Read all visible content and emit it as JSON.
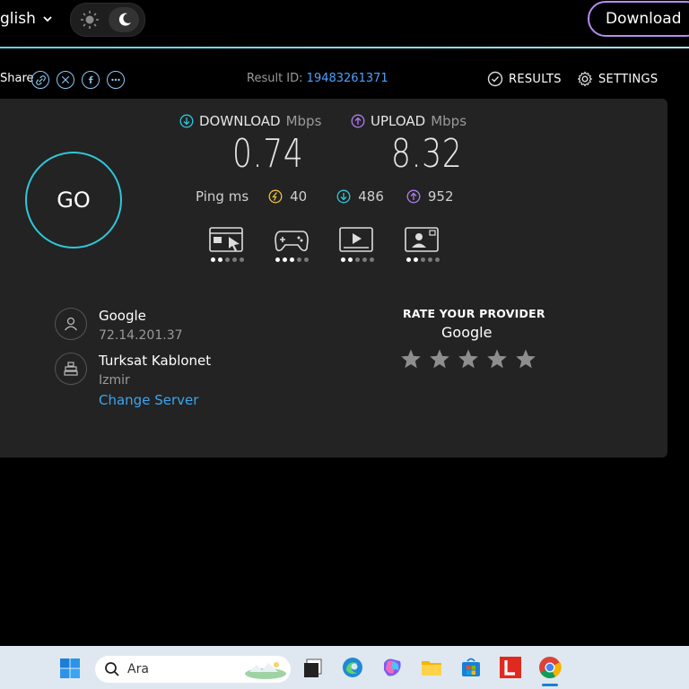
{
  "topbar": {
    "language": "glish",
    "download_button": "Download"
  },
  "share": {
    "label": "Share",
    "result_id_label": "Result ID:",
    "result_id": "19483261371",
    "results_link": "RESULTS",
    "settings_link": "SETTINGS"
  },
  "test": {
    "go_label": "GO",
    "download": {
      "label": "DOWNLOAD",
      "unit": "Mbps",
      "value": "0.74"
    },
    "upload": {
      "label": "UPLOAD",
      "unit": "Mbps",
      "value": "8.32"
    },
    "ping": {
      "label": "Ping",
      "unit": "ms",
      "idle": "40",
      "download": "486",
      "upload": "952"
    },
    "quality": [
      {
        "name": "browsing",
        "level": 2,
        "max": 5
      },
      {
        "name": "gaming",
        "level": 3,
        "max": 5
      },
      {
        "name": "streaming",
        "level": 2,
        "max": 5
      },
      {
        "name": "video-calls",
        "level": 2,
        "max": 5
      }
    ]
  },
  "server": {
    "isp_name": "Google",
    "ip": "72.14.201.37",
    "host_name": "Turksat Kablonet",
    "host_city": "Izmir",
    "change_server": "Change Server"
  },
  "rating": {
    "title": "RATE YOUR PROVIDER",
    "provider": "Google",
    "stars": 5
  },
  "taskbar": {
    "search_placeholder": "Ara"
  },
  "colors": {
    "accent_cyan": "#2fc7d9",
    "upload_purple": "#b07cf0",
    "link_blue": "#3da5f0",
    "ping_yellow": "#e8c23a"
  }
}
